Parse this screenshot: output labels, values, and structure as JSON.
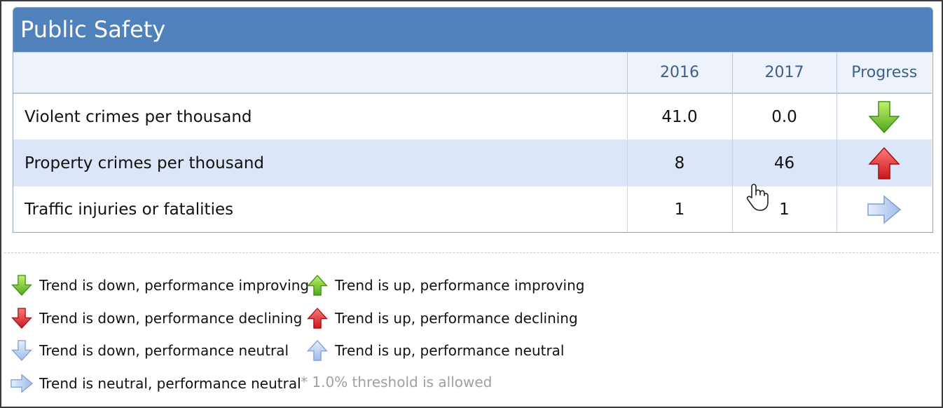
{
  "panel": {
    "title": "Public Safety",
    "columns": [
      "",
      "2016",
      "2017",
      "Progress"
    ]
  },
  "rows": [
    {
      "label": "Violent crimes per thousand",
      "y2016": "41.0",
      "y2017": "0.0",
      "progress_icon": "arrow-down-green-icon"
    },
    {
      "label": "Property crimes per thousand",
      "y2016": "8",
      "y2017": "46",
      "progress_icon": "arrow-up-red-icon"
    },
    {
      "label": "Traffic injuries or fatalities",
      "y2016": "1",
      "y2017": "1",
      "progress_icon": "arrow-right-blue-icon"
    }
  ],
  "legend": {
    "down_improving": "Trend is down, performance improving",
    "up_improving": "Trend is up, performance improving",
    "down_declining": "Trend is down, performance declining",
    "up_declining": "Trend is up, performance declining",
    "down_neutral": "Trend is down, performance neutral",
    "up_neutral": "Trend is up, performance neutral",
    "neutral_neutral": "Trend is neutral, performance neutral",
    "threshold_note": "* 1.0% threshold is allowed"
  },
  "colors": {
    "header_bg": "#4f81bd",
    "alt_row_bg": "#dbe6f9",
    "green": "#7ac943",
    "red": "#e5333b",
    "neutral_blue": "#aac4ee"
  }
}
